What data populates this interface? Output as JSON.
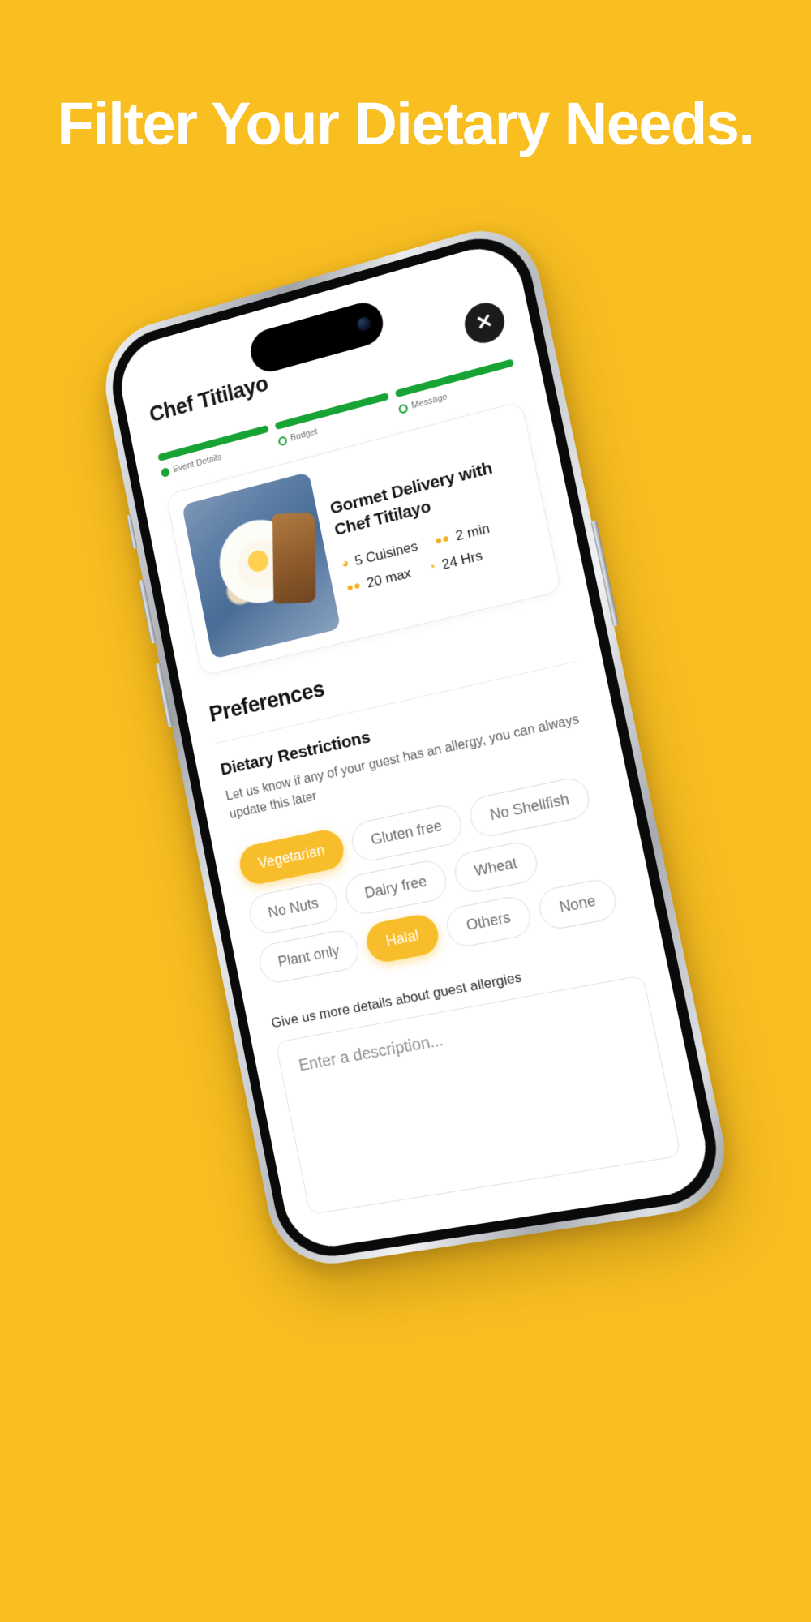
{
  "poster": {
    "headline": "Filter Your Dietary Needs.",
    "background_color": "#F9BE20",
    "headline_color": "#FFFFFF"
  },
  "app": {
    "title": "Chef Titilayo",
    "close_label": "✕",
    "accent_color": "#F8BD2A",
    "progress_color": "#18A335",
    "stepper": [
      {
        "label": "Event Details",
        "state": "done"
      },
      {
        "label": "Budget",
        "state": "done"
      },
      {
        "label": "Message",
        "state": "current"
      }
    ],
    "chef_card": {
      "image_name": "food-plate-photo",
      "name": "Gormet Delivery with Chef Titilayo",
      "meta": [
        {
          "icon": "cuisine-icon",
          "glyph": "◕",
          "text": "5 Cuisines"
        },
        {
          "icon": "people-icon",
          "glyph": "●●",
          "text": "2 min"
        },
        {
          "icon": "guests-icon",
          "glyph": "●●",
          "text": "20 max"
        },
        {
          "icon": "clock-icon",
          "glyph": "◔",
          "text": "24 Hrs"
        }
      ]
    },
    "preferences": {
      "section_title": "Preferences",
      "sub_title": "Dietary Restrictions",
      "description": "Let us know if any of your guest has an allergy, you can always update this later",
      "chips": [
        {
          "label": "Vegetarian",
          "selected": true
        },
        {
          "label": "Gluten free",
          "selected": false
        },
        {
          "label": "No Shellfish",
          "selected": false
        },
        {
          "label": "No Nuts",
          "selected": false
        },
        {
          "label": "Dairy free",
          "selected": false
        },
        {
          "label": "Wheat",
          "selected": false
        },
        {
          "label": "Plant only",
          "selected": false
        },
        {
          "label": "Halal",
          "selected": true
        },
        {
          "label": "Others",
          "selected": false
        },
        {
          "label": "None",
          "selected": false
        }
      ]
    },
    "allergy_details": {
      "label": "Give us more details about guest allergies",
      "placeholder": "Enter a description...",
      "value": ""
    }
  }
}
